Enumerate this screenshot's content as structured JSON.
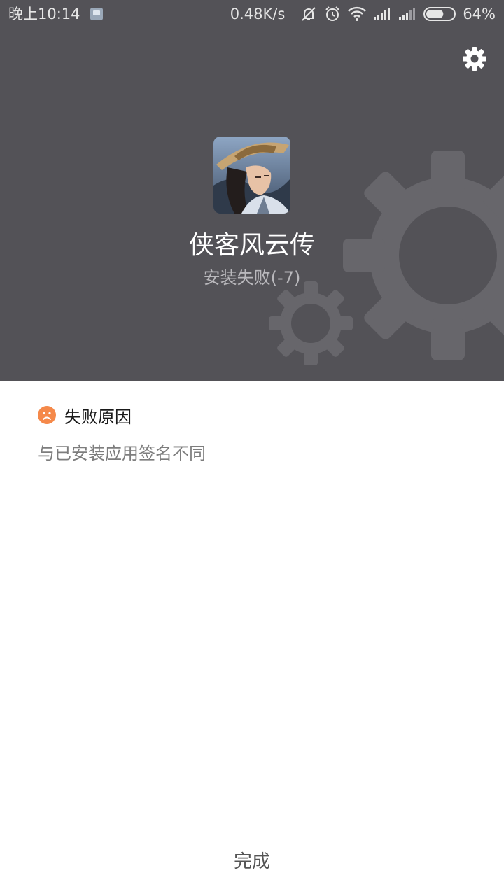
{
  "status_bar": {
    "time": "晚上10:14",
    "network_speed": "0.48K/s",
    "battery_percent": "64%",
    "battery_level": 0.64,
    "icons": [
      "notification-icon",
      "mute-vibrate-icon",
      "alarm-icon",
      "wifi-icon",
      "signal-icon",
      "signal-icon",
      "battery-icon"
    ]
  },
  "header": {
    "settings_icon": "gear-icon",
    "background_color": "#535257"
  },
  "app": {
    "name": "侠客风云传",
    "install_status": "安装失败(-7)"
  },
  "failure": {
    "title": "失败原因",
    "icon": "sad-face-icon",
    "icon_color": "#f5894a",
    "reason": "与已安装应用签名不同"
  },
  "footer": {
    "done_label": "完成"
  }
}
